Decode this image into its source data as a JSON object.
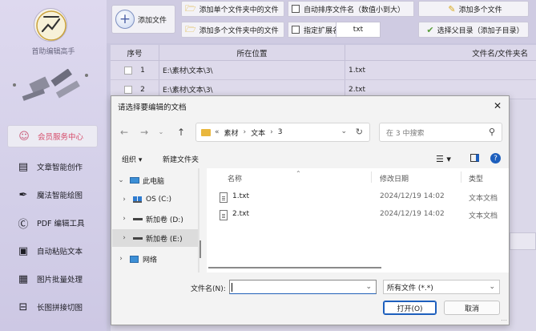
{
  "sidebar": {
    "app_name": "首助编辑高手",
    "items": [
      {
        "label": "会员服务中心",
        "icon": "user-icon"
      },
      {
        "label": "文章智能创作",
        "icon": "article-icon"
      },
      {
        "label": "魔法智能绘图",
        "icon": "magic-pen-icon"
      },
      {
        "label": "PDF 编辑工具",
        "icon": "pdf-icon"
      },
      {
        "label": "自动粘贴文本",
        "icon": "paste-icon"
      },
      {
        "label": "图片批量处理",
        "icon": "image-icon"
      },
      {
        "label": "长图拼接切图",
        "icon": "stitch-icon"
      }
    ]
  },
  "toolbar": {
    "add_file": "添加文件",
    "add_single_folder": "添加单个文件夹中的文件",
    "add_multi_folder": "添加多个文件夹中的文件",
    "auto_sort": "自动排序文件名（数值小到大）",
    "specify_ext": "指定扩展名:",
    "ext_value": "txt",
    "add_multi_files": "添加多个文件",
    "select_parent": "选择父目录（添加子目录）"
  },
  "table": {
    "headers": {
      "index": "序号",
      "location": "所在位置",
      "name": "文件名/文件夹名"
    },
    "rows": [
      {
        "index": "1",
        "location": "E:\\素材\\文本\\3\\",
        "name": "1.txt"
      },
      {
        "index": "2",
        "location": "E:\\素材\\文本\\3\\",
        "name": "2.txt"
      }
    ]
  },
  "dialog": {
    "title": "请选择要编辑的文档",
    "address": {
      "prefix": "«",
      "crumbs": [
        "素材",
        "文本",
        "3"
      ]
    },
    "search_placeholder": "在 3 中搜索",
    "organize": "组织 ▾",
    "new_folder": "新建文件夹",
    "tree": [
      {
        "label": "此电脑",
        "chevron": "⌄"
      },
      {
        "label": "OS (C:)",
        "chevron": "›"
      },
      {
        "label": "新加卷 (D:)",
        "chevron": "›"
      },
      {
        "label": "新加卷 (E:)",
        "chevron": "›"
      },
      {
        "label": "网络",
        "chevron": "›"
      }
    ],
    "columns": {
      "name": "名称",
      "date": "修改日期",
      "type": "类型"
    },
    "files": [
      {
        "name": "1.txt",
        "date": "2024/12/19 14:02",
        "type": "文本文档"
      },
      {
        "name": "2.txt",
        "date": "2024/12/19 14:02",
        "type": "文本文档"
      }
    ],
    "filename_label": "文件名(N):",
    "filename_value": "",
    "filetype": "所有文件 (*.*)",
    "open_button": "打开(O)",
    "cancel_button": "取消"
  },
  "colors": {
    "accent": "#1d5fbd",
    "vip_text": "#d64b6a",
    "folder": "#e9b73d"
  }
}
